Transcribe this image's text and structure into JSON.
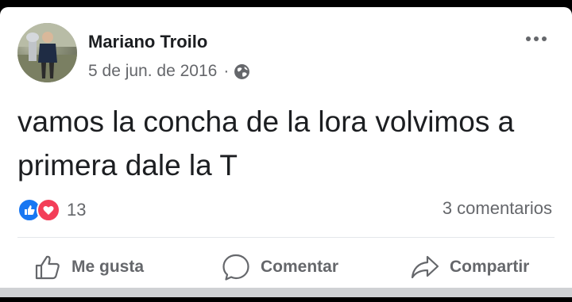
{
  "post": {
    "author": "Mariano Troilo",
    "date": "5 de jun. de 2016",
    "separator": "·",
    "privacy_icon": "globe-icon",
    "text": "vamos la concha de la lora volvimos a primera dale la T"
  },
  "engagement": {
    "reaction_count": "13",
    "comments": "3 comentarios",
    "reaction_icons": [
      "like-icon",
      "love-icon"
    ]
  },
  "actions": {
    "like_label": "Me gusta",
    "comment_label": "Comentar",
    "share_label": "Compartir"
  },
  "colors": {
    "like_blue": "#1877f2",
    "love_red": "#f33e58",
    "secondary_text": "#65676b",
    "primary_text": "#1c1e21"
  }
}
